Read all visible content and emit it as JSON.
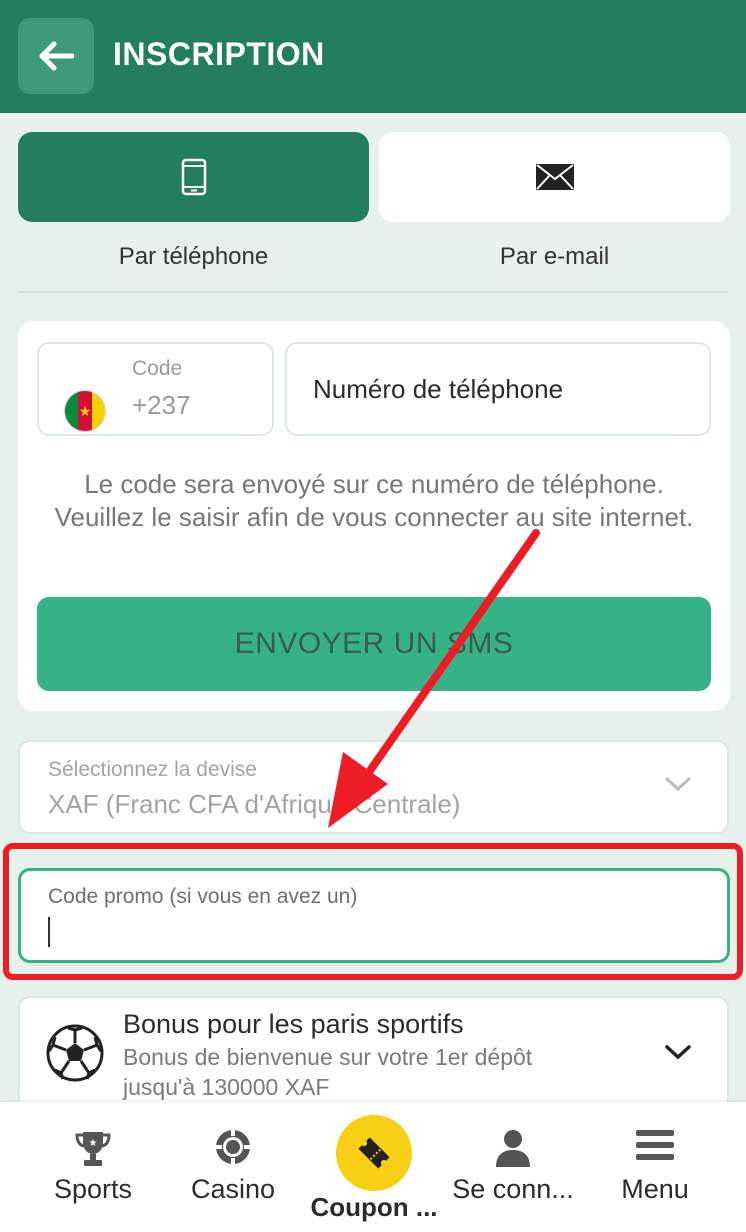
{
  "header": {
    "title": "INSCRIPTION",
    "back_icon": "arrow-left-icon"
  },
  "method_tabs": [
    {
      "label": "Par téléphone",
      "icon": "smartphone-icon",
      "active": true
    },
    {
      "label": "Par e-mail",
      "icon": "envelope-icon",
      "active": false
    }
  ],
  "phone_form": {
    "code_label": "Code",
    "code_value": "+237",
    "country_flag": "cameroon-flag-icon",
    "phone_placeholder": "Numéro de téléphone",
    "info_text": "Le code sera envoyé sur ce numéro de téléphone. Veuillez le saisir afin de vous connecter au site internet.",
    "sms_button": "ENVOYER UN SMS"
  },
  "currency": {
    "label": "Sélectionnez la devise",
    "value": "XAF  (Franc CFA d'Afrique Centrale)"
  },
  "promo": {
    "placeholder": "Code promo (si vous en avez un)",
    "value": ""
  },
  "bonus": {
    "title": "Bonus pour les paris sportifs",
    "description": "Bonus de bienvenue sur votre 1er dépôt jusqu'à 130000 XAF",
    "icon": "soccer-ball-icon"
  },
  "bottom_nav": {
    "items": [
      {
        "label": "Sports",
        "icon": "trophy-icon"
      },
      {
        "label": "Casino",
        "icon": "casino-chip-icon"
      },
      {
        "label": "Coupon ...",
        "icon": "ticket-icon"
      },
      {
        "label": "Se conn...",
        "icon": "user-icon"
      },
      {
        "label": "Menu",
        "icon": "hamburger-icon"
      }
    ]
  },
  "colors": {
    "primary": "#237f5b",
    "accent": "#35b386",
    "coupon": "#f7cf14",
    "annotation": "#ee1c25",
    "background": "#e8f0ec"
  }
}
